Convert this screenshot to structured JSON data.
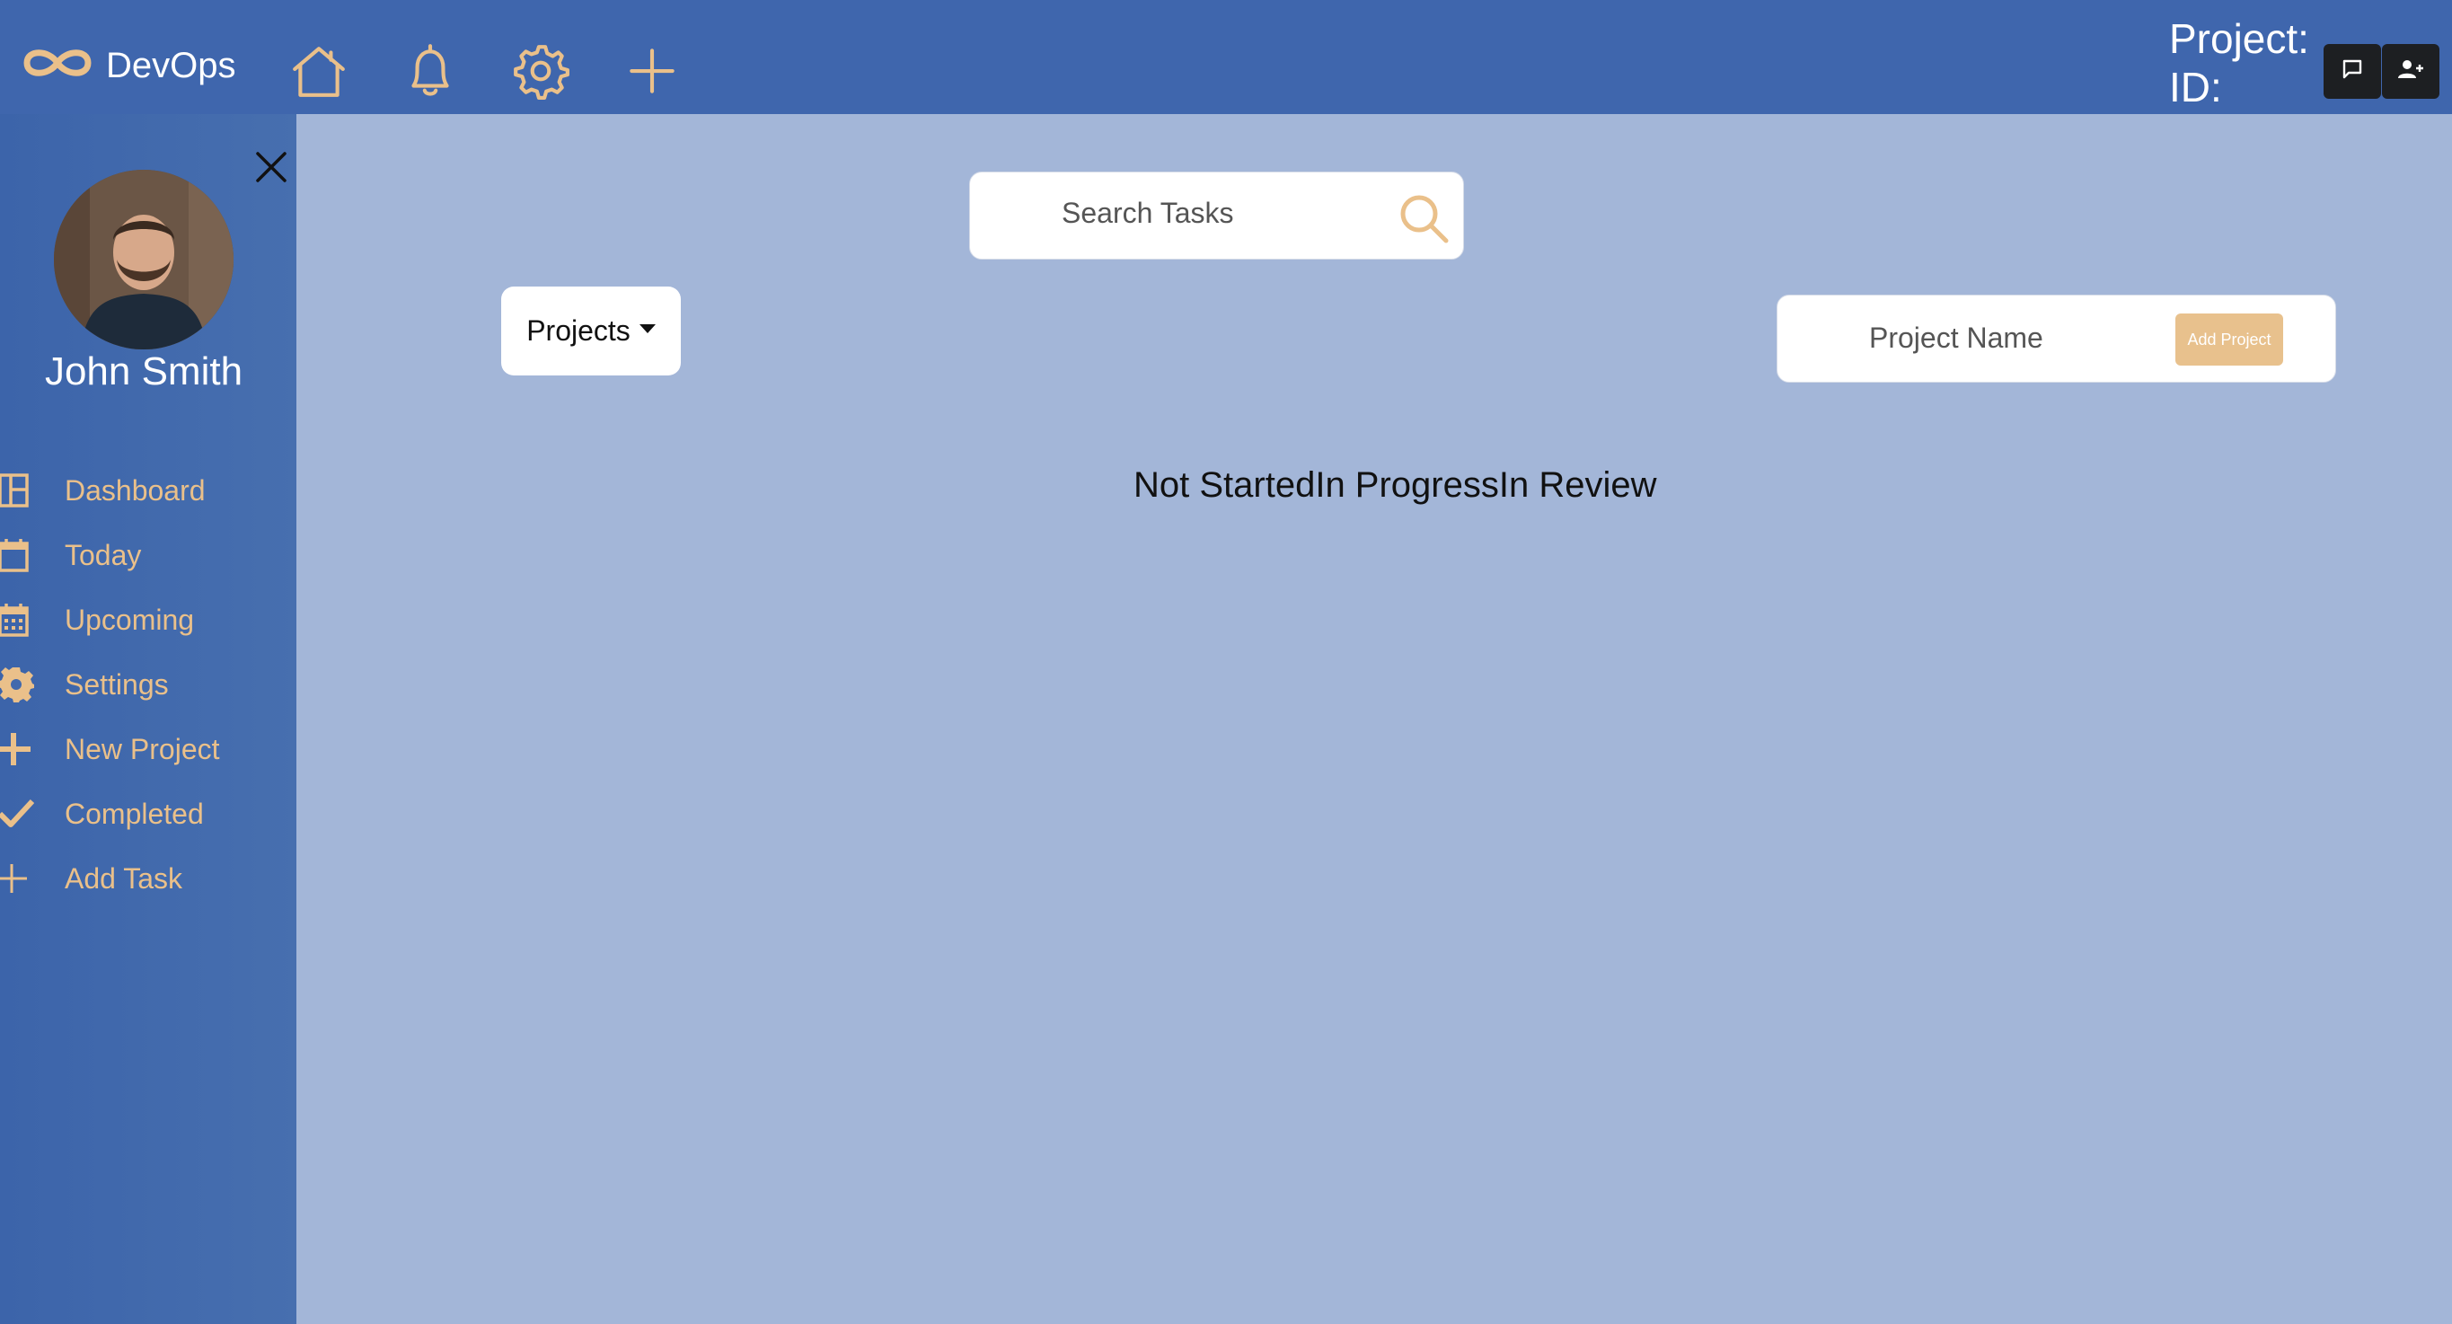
{
  "header": {
    "brand": "DevOps",
    "project_label": "Project:",
    "id_label": "ID:",
    "nav_icons": [
      "home-icon",
      "bell-icon",
      "gear-icon",
      "plus-icon"
    ],
    "action_buttons": [
      "chat-icon",
      "add-user-icon"
    ],
    "background": "#3f66ad"
  },
  "sidebar": {
    "user_name": "John Smith",
    "items": [
      {
        "label": "Dashboard",
        "icon": "dashboard-icon"
      },
      {
        "label": "Today",
        "icon": "calendar-icon"
      },
      {
        "label": "Upcoming",
        "icon": "calendar-grid-icon"
      },
      {
        "label": "Settings",
        "icon": "gear-icon"
      },
      {
        "label": "New Project",
        "icon": "plus-icon"
      },
      {
        "label": "Completed",
        "icon": "check-icon"
      },
      {
        "label": "Add Task",
        "icon": "plus-thin-icon"
      }
    ],
    "accent": "#eac08a"
  },
  "main": {
    "search_placeholder": "Search Tasks",
    "projects_dropdown": "Projects",
    "project_name_placeholder": "Project Name",
    "add_project_label": "Add Project",
    "status_columns": [
      "Not Started",
      "In Progress",
      "In Review"
    ],
    "background": "#a3b6d8"
  }
}
